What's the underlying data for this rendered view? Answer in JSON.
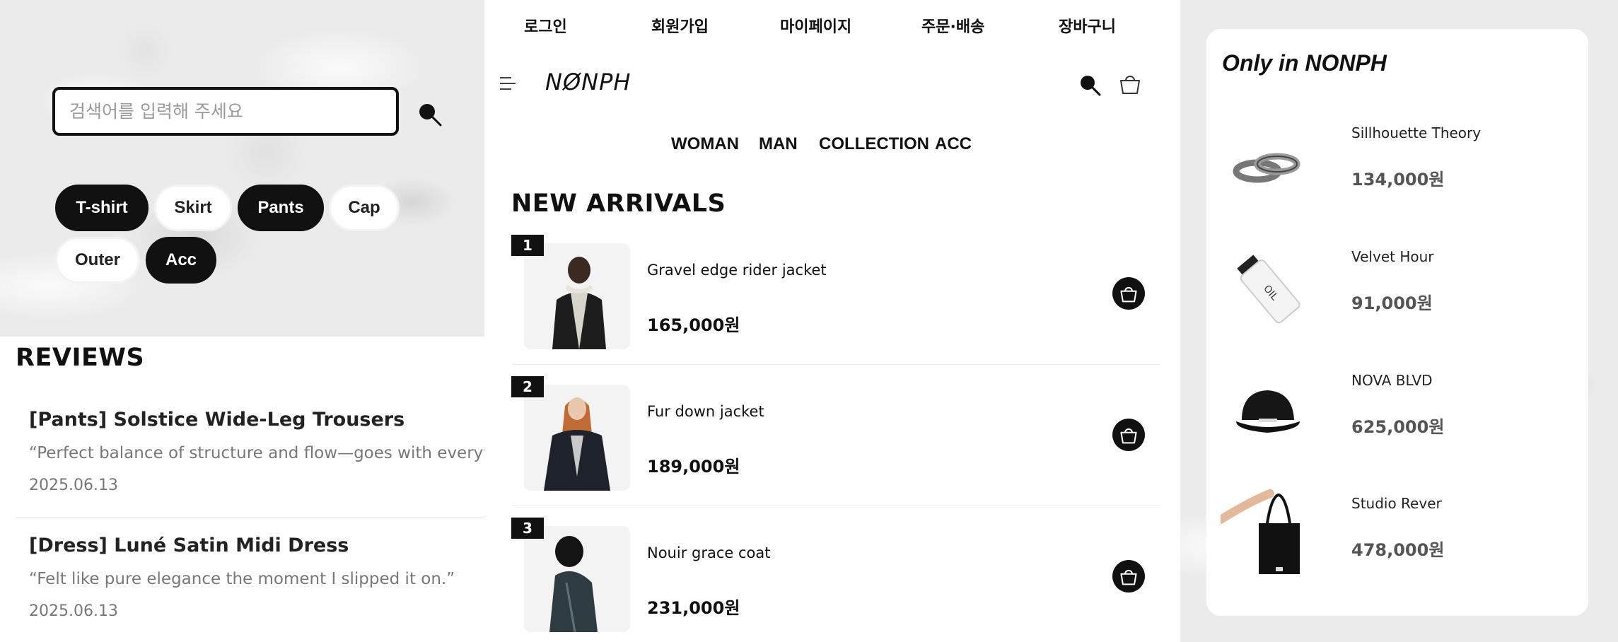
{
  "search": {
    "placeholder": "검색어를 입력해 주세요"
  },
  "tags": [
    {
      "label": "T-shirt",
      "style": "dark"
    },
    {
      "label": "Skirt",
      "style": "light"
    },
    {
      "label": "Pants",
      "style": "dark"
    },
    {
      "label": "Cap",
      "style": "light"
    },
    {
      "label": "Outer",
      "style": "light"
    },
    {
      "label": "Acc",
      "style": "dark"
    }
  ],
  "reviews": {
    "title": "REVIEWS",
    "items": [
      {
        "title": "[Pants] Solstice Wide-Leg Trousers",
        "quote": "“Perfect balance of structure and flow—goes with everything.”",
        "date": "2025.06.13"
      },
      {
        "title": "[Dress] Luné Satin Midi Dress",
        "quote": "“Felt like pure elegance the moment I slipped it on.”",
        "date": "2025.06.13"
      }
    ]
  },
  "topnav": [
    "로그인",
    "회원가입",
    "마이페이지",
    "주문·배송",
    "장바구니"
  ],
  "brand": {
    "logo": "NØNPH"
  },
  "categories": [
    "WOMAN",
    "MAN",
    "COLLECTION",
    "ACC"
  ],
  "new_arrivals": {
    "title": "NEW ARRIVALS",
    "items": [
      {
        "rank": "1",
        "name": "Gravel edge rider jacket",
        "price": "165,000원"
      },
      {
        "rank": "2",
        "name": "Fur down jacket",
        "price": "189,000원"
      },
      {
        "rank": "3",
        "name": "Nouir grace coat",
        "price": "231,000원"
      }
    ]
  },
  "only_in": {
    "title": "Only in NONPH",
    "items": [
      {
        "name": "Sillhouette Theory",
        "price": "134,000원",
        "icon": "rings-image"
      },
      {
        "name": "Velvet Hour",
        "price": "91,000원",
        "icon": "oil-bottle-image"
      },
      {
        "name": "NOVA BLVD",
        "price": "625,000원",
        "icon": "black-cap-image"
      },
      {
        "name": "Studio Rever",
        "price": "478,000원",
        "icon": "tote-bag-image"
      }
    ]
  },
  "colors": {
    "accent": "#111111",
    "muted_text": "#777777",
    "background": "#ffffff"
  }
}
